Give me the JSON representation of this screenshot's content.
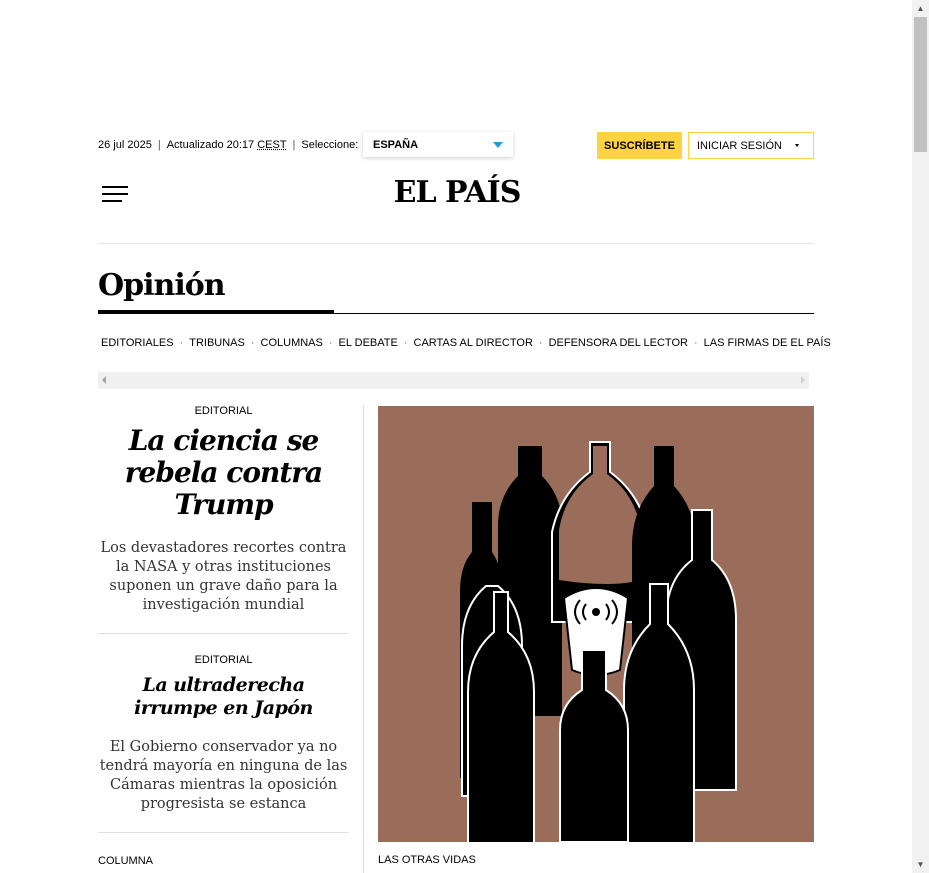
{
  "header": {
    "date": "26 jul 2025",
    "updated": "Actualizado 20:17",
    "timezone": "CEST",
    "select_label": "Seleccione:",
    "edition": "ESPAÑA",
    "subscribe": "SUSCRÍBETE",
    "login": "INICIAR SESIÓN",
    "logo": "EL PAÍS"
  },
  "section": {
    "title": "Opinión",
    "nav": [
      "EDITORIALES",
      "TRIBUNAS",
      "COLUMNAS",
      "EL DEBATE",
      "CARTAS AL DIRECTOR",
      "DEFENSORA DEL LECTOR",
      "LAS FIRMAS DE EL PAÍS"
    ]
  },
  "articles": [
    {
      "kicker": "EDITORIAL",
      "headline": "La ciencia se rebela contra Trump",
      "summary": "Los devastadores recortes contra la NASA y otras instituciones suponen un grave daño para la investigación mundial"
    },
    {
      "kicker": "EDITORIAL",
      "headline": "La ultraderecha irrumpe en Japón",
      "summary": "El Gobierno conservador ya no tendrá mayoría en ninguna de las Cámaras mientras la oposición progresista se estanca"
    },
    {
      "kicker": "COLUMNA"
    }
  ],
  "hero": {
    "kicker": "LAS OTRAS VIDAS",
    "illustration": "bottles-around-glass"
  },
  "colors": {
    "subscribe_bg": "#ffd23f",
    "edition_arrow": "#1a9ed9",
    "hero_bg": "#9a6c5a"
  }
}
